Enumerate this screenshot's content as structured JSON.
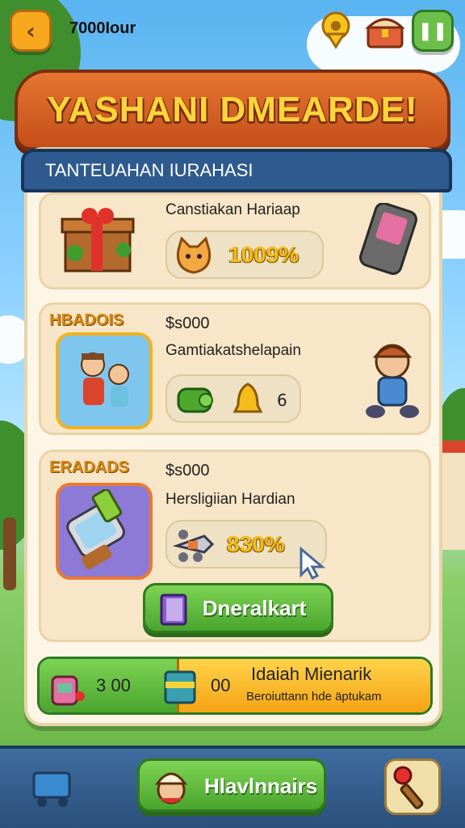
{
  "top_bar": {
    "back_icon": "chevron-left-icon",
    "currency": "7000Iour",
    "pin_icon": "location-pin-icon",
    "chest_icon": "treasure-chest-icon",
    "pause_icon": "pause-icon"
  },
  "banner": {
    "title": "YASHANI DMEARDE!"
  },
  "panel": {
    "header": "TANTEUAHAN IURAHASI",
    "cards": [
      {
        "description": "Canstiakan Hariaap",
        "percent": "1009%",
        "left_icon": "gift-box-icon",
        "pill_icon": "cat-face-icon",
        "right_icon": "phone-device-icon"
      },
      {
        "tag": "HBADOIS",
        "price": "$s000",
        "description": "Gamtiakatshelapain",
        "count": "6",
        "left_icon": "family-characters-icon",
        "pill_icon_1": "green-gadget-icon",
        "pill_icon_2": "golden-bell-icon",
        "right_icon": "doll-character-icon"
      },
      {
        "tag": "ERADADS",
        "price": "$s000",
        "description": "Hersligiian Hardian",
        "percent": "830%",
        "left_icon": "smartwatch-icon",
        "pill_icon": "drone-icon",
        "cursor_icon": "pointer-cursor-icon"
      }
    ],
    "claim_button": "Dneralkart",
    "claim_icon": "book-icon",
    "reward_bar": {
      "left_value": "3 00",
      "mid_value": "00",
      "title": "Idaiah Mienarik",
      "subtitle": "Beroiuttann hde äptukam",
      "left_icon": "backpack-icon",
      "mid_icon": "supply-box-icon"
    }
  },
  "bottom_bar": {
    "home_button": "Hlavlnnairs",
    "home_icon": "chef-character-icon",
    "left_icon": "shopping-cart-icon",
    "right_icon": "magic-wand-icon"
  }
}
